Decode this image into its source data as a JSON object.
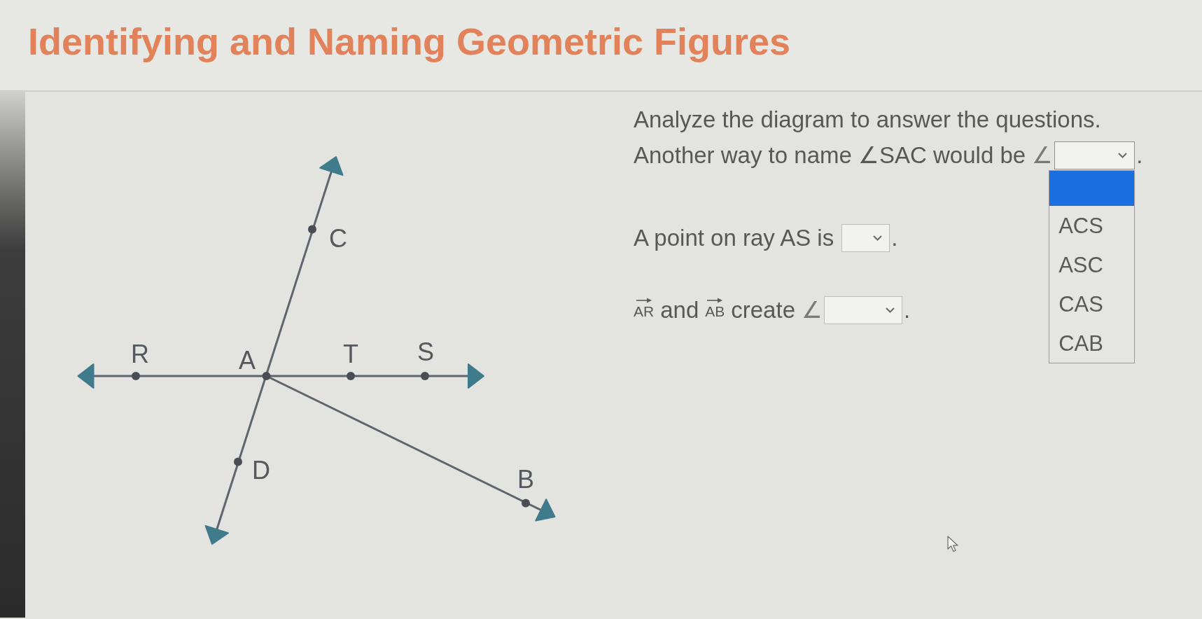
{
  "page": {
    "title": "Identifying and Naming Geometric Figures"
  },
  "diagram": {
    "points": [
      {
        "label": "C"
      },
      {
        "label": "R"
      },
      {
        "label": "A"
      },
      {
        "label": "T"
      },
      {
        "label": "S"
      },
      {
        "label": "D"
      },
      {
        "label": "B"
      }
    ]
  },
  "instructions": "Analyze the diagram to answer the questions.",
  "questions": [
    {
      "parts": [
        {
          "kind": "text",
          "text": "Another way to name ∠SAC would be"
        },
        {
          "kind": "angle",
          "text": "∠"
        },
        {
          "kind": "dropdown",
          "expanded": true,
          "options": [
            {
              "selected": true
            },
            {
              "label": "ACS",
              "selected": false
            },
            {
              "label": "ASC",
              "selected": false
            },
            {
              "label": "CAS",
              "selected": false
            },
            {
              "label": "CAB",
              "selected": false
            }
          ]
        },
        {
          "kind": "text",
          "text": "."
        }
      ]
    },
    {
      "parts": [
        {
          "kind": "text",
          "text": "A point on ray AS is"
        },
        {
          "kind": "dropdown",
          "expanded": false
        },
        {
          "kind": "text",
          "text": "."
        }
      ]
    },
    {
      "parts": [
        {
          "kind": "ray",
          "text": "AR"
        },
        {
          "kind": "text",
          "text": "and"
        },
        {
          "kind": "ray",
          "text": "AB"
        },
        {
          "kind": "text",
          "text": "create"
        },
        {
          "kind": "angle",
          "text": "∠"
        },
        {
          "kind": "dropdown",
          "expanded": false
        },
        {
          "kind": "text",
          "text": "."
        }
      ]
    }
  ]
}
